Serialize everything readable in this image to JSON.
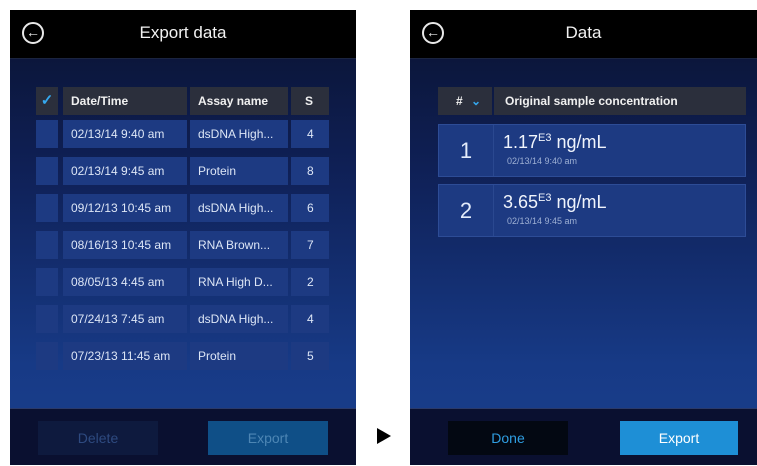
{
  "left": {
    "title": "Export data",
    "columns": [
      "Date/Time",
      "Assay name",
      "S"
    ],
    "header_check": "✓",
    "rows": [
      {
        "date": "02/13/14 9:40 am",
        "assay": "dsDNA High...",
        "s": "4"
      },
      {
        "date": "02/13/14 9:45 am",
        "assay": "Protein",
        "s": "8"
      },
      {
        "date": "09/12/13 10:45 am",
        "assay": "dsDNA High...",
        "s": "6"
      },
      {
        "date": "08/16/13 10:45 am",
        "assay": "RNA Brown...",
        "s": "7"
      },
      {
        "date": "08/05/13 4:45 am",
        "assay": "RNA High D...",
        "s": "2"
      },
      {
        "date": "07/24/13 7:45 am",
        "assay": "dsDNA High...",
        "s": "4"
      },
      {
        "date": "07/23/13 11:45 am",
        "assay": "Protein",
        "s": "5"
      }
    ],
    "delete_label": "Delete",
    "export_label": "Export"
  },
  "right": {
    "title": "Data",
    "col_num": "#",
    "col_sort_icon": "chevron-down-icon",
    "col_conc": "Original sample concentration",
    "rows": [
      {
        "num": "1",
        "value": "1.17",
        "exp": "E3",
        "unit": "ng/mL",
        "time": "02/13/14 9:40 am"
      },
      {
        "num": "2",
        "value": "3.65",
        "exp": "E3",
        "unit": "ng/mL",
        "time": "02/13/14 9:45 am"
      }
    ],
    "done_label": "Done",
    "export_label": "Export"
  },
  "colors": {
    "accent": "#1e8fd6",
    "row": "#1d3a82",
    "header_bar": "#000000",
    "check": "#35a8ee"
  }
}
